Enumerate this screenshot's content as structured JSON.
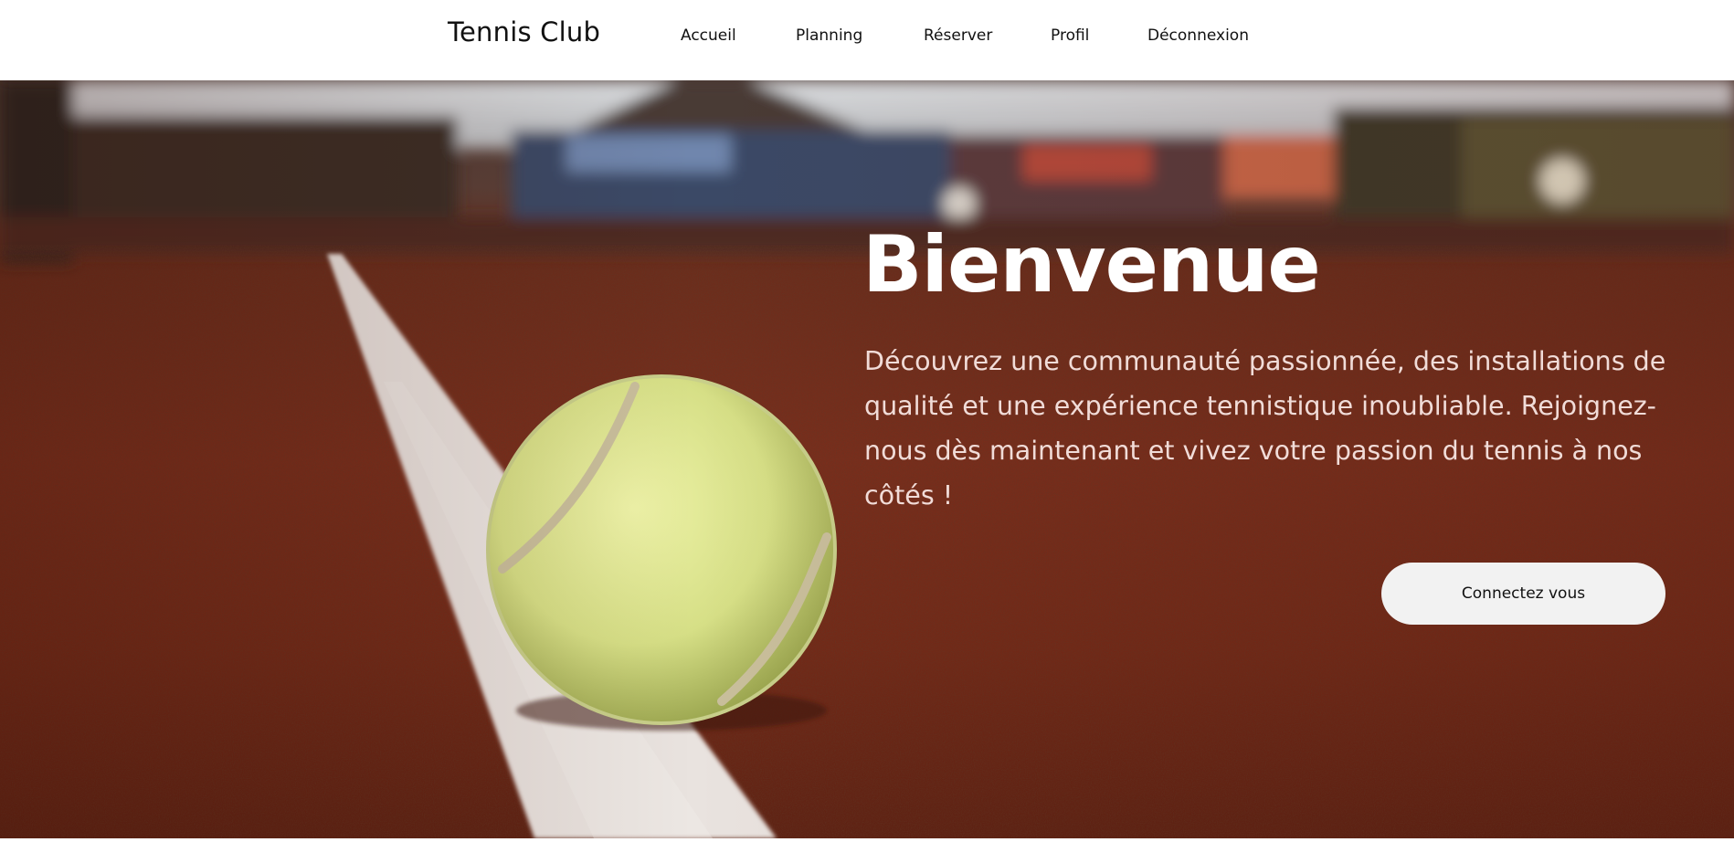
{
  "header": {
    "brand": "Tennis Club",
    "nav": [
      {
        "label": "Accueil"
      },
      {
        "label": "Planning"
      },
      {
        "label": "Réserver"
      },
      {
        "label": "Profil"
      },
      {
        "label": "Déconnexion"
      }
    ]
  },
  "hero": {
    "title": "Bienvenue",
    "text": "Découvrez une communauté passionnée, des installations de qualité et une expérience tennistique inoubliable. Rejoignez-nous dès maintenant et vivez votre passion du tennis à nos côtés !",
    "cta_label": "Connectez vous",
    "background_image": "tennis-ball-on-clay-court"
  },
  "colors": {
    "clay": "#7a2e1c",
    "ball": "#d8e08a",
    "button_bg": "#f2f2f2",
    "text_light": "#f1dcd8"
  }
}
